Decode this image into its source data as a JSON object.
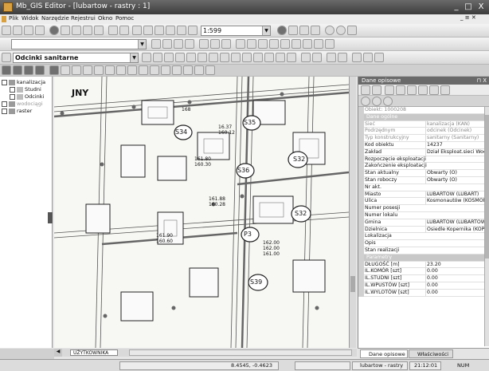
{
  "window": {
    "title": "Mb_GIS Editor - [lubartow - rastry : 1]",
    "min_label": "_",
    "max_label": "□",
    "close_label": "X",
    "mdi_controls": "_ ≡ ✕"
  },
  "menu": [
    "Plik",
    "Widok",
    "Narzędzie",
    "Rejestrui",
    "Okno",
    "Pomoc"
  ],
  "toolbar": {
    "scale": "1:599",
    "object_type": "Odcinki sanitarne"
  },
  "layers": [
    {
      "label": "kanalizacja",
      "checked": true
    },
    {
      "label": "Studni",
      "checked": true
    },
    {
      "label": "Odcinki",
      "checked": true
    },
    {
      "label": "wodociągi",
      "checked": true
    },
    {
      "label": "raster",
      "checked": true
    }
  ],
  "map": {
    "labels": [
      "S34",
      "S35",
      "S36",
      "P3",
      "S32",
      "S32",
      "S39"
    ],
    "text_marker": "JNY",
    "numbers": [
      "168",
      "16.37",
      "160.12",
      "161.80",
      "160.30",
      "161.88",
      "160.28",
      "162.00",
      "161.90",
      "160.60",
      "162.00",
      "161.00"
    ]
  },
  "map_tab": "UŻYTKOWNIKA",
  "right_panel": {
    "title": "Dane opisowe",
    "pin": "⊓ X",
    "rows": [
      {
        "label": "Obiekt: 1000208",
        "value": "",
        "kind": "grey"
      },
      {
        "label": "Dane ogólne",
        "value": "",
        "kind": "cat"
      },
      {
        "label": "Sieć",
        "value": "kanalizacja (KAN)",
        "kind": "grey"
      },
      {
        "label": "Podrzędnym",
        "value": "odcinek (Odcinek)",
        "kind": "grey"
      },
      {
        "label": "Typ konstrukcyjny",
        "value": "sanitarny (Sanitarny)",
        "kind": "grey"
      },
      {
        "label": "Kod obiektu",
        "value": "14237",
        "kind": "normal"
      },
      {
        "label": "Zakład",
        "value": "Dział Eksploat.sieci Woc",
        "kind": "normal"
      },
      {
        "label": "Rozpoczęcie eksploatacji",
        "value": "",
        "kind": "normal"
      },
      {
        "label": "Zakończenie eksploatacji",
        "value": "",
        "kind": "normal"
      },
      {
        "label": "Stan aktualny",
        "value": "Obwarty (O)",
        "kind": "normal"
      },
      {
        "label": "Stan roboczy",
        "value": "Obwarty (O)",
        "kind": "normal"
      },
      {
        "label": "Nr akt.",
        "value": "",
        "kind": "normal"
      },
      {
        "label": "Miasto",
        "value": "LUBARTÓW (LUBART)",
        "kind": "normal"
      },
      {
        "label": "Ulica",
        "value": "Kosmonautów (KOSMON",
        "kind": "normal"
      },
      {
        "label": "Numer posesji",
        "value": "",
        "kind": "normal"
      },
      {
        "label": "Numer lokalu",
        "value": "",
        "kind": "normal"
      },
      {
        "label": "Gmina",
        "value": "LUBARTÓW (LUBARTOW",
        "kind": "normal"
      },
      {
        "label": "Dzielnica",
        "value": "Osiedle Kopernika (KOPI",
        "kind": "normal"
      },
      {
        "label": "Lokalizacja",
        "value": "",
        "kind": "normal"
      },
      {
        "label": "Opis",
        "value": "",
        "kind": "normal"
      },
      {
        "label": "Stan realizacji",
        "value": "",
        "kind": "normal"
      },
      {
        "label": "Parametry",
        "value": "",
        "kind": "cat"
      },
      {
        "label": "DŁUGOŚĆ [m]",
        "value": "23.20",
        "kind": "normal"
      },
      {
        "label": "IL.KOMÓR [szt]",
        "value": "0.00",
        "kind": "normal"
      },
      {
        "label": "IL.STUDNI [szt]",
        "value": "0.00",
        "kind": "normal"
      },
      {
        "label": "IL.WPUSTÓW [szt]",
        "value": "0.00",
        "kind": "normal"
      },
      {
        "label": "IL.WYLOTÓW [szt]",
        "value": "0.00",
        "kind": "normal"
      }
    ]
  },
  "tabs": [
    "Dane opisowe",
    "Właściwości"
  ],
  "status": {
    "coords": "8.4545, -0.4623",
    "layer": "lubartow - rastry",
    "time": "21:12:01",
    "num": "NUM"
  }
}
